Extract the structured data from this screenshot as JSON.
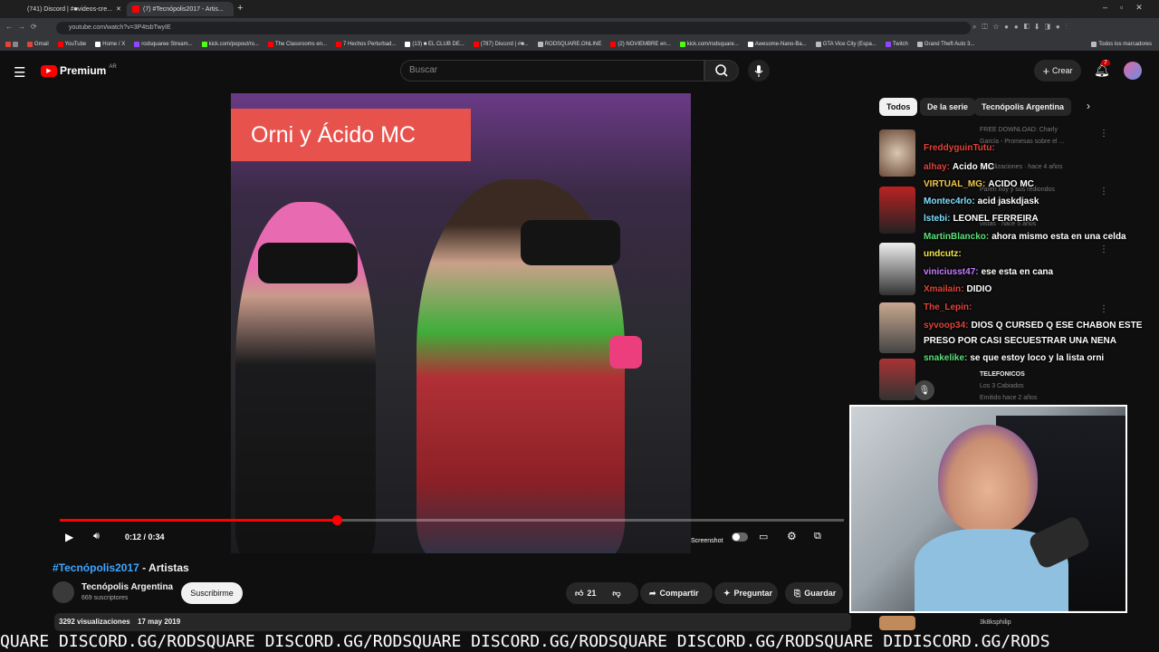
{
  "browser": {
    "tabs": [
      {
        "label": "(741) Discord | #■videos-cre...",
        "active": false
      },
      {
        "label": "(7) #Tecnópolis2017 - Artis...",
        "active": true
      }
    ],
    "url": "youtube.com/watch?v=3P4tsbTwyIE",
    "bookmarks": [
      "Gmail",
      "YouTube",
      "Home / X",
      "rodsquaree Stream...",
      "kick.com/popout/ro...",
      "The Classrooms en...",
      "7 Hechos Perturbad...",
      "(13) ■ EL CLUB DE...",
      "(787) Discord | #■...",
      "RODSQUARE.ONLINE",
      "(2) NOVIEMBRE en...",
      "kick.com/rodsquare...",
      "Awesome-Nano-Ba...",
      "GTA Vice City (Espa...",
      "Twitch",
      "Grand Theft Auto 3..."
    ],
    "all_bookmarks": "Todos los marcadores"
  },
  "youtube": {
    "logo_text": "Premium",
    "logo_region": "AR",
    "search_placeholder": "Buscar",
    "create_label": "Crear",
    "notif_count": "7"
  },
  "video": {
    "caption": "Orni y Ácido MC",
    "time": "0:12 / 0:34",
    "progress": 0.353,
    "screenshot_label": "Screenshot",
    "title_hashtag": "#Tecnópolis2017",
    "title_rest": " - Artistas",
    "channel": "Tecnópolis Argentina",
    "subscribers": "669 suscriptores",
    "subscribe_label": "Suscribirme",
    "likes": "21",
    "share_label": "Compartir",
    "ask_label": "Preguntar",
    "save_label": "Guardar",
    "views": "3292 visualizaciones",
    "date": "17 may 2019"
  },
  "chips": [
    {
      "label": "Todos",
      "selected": true
    },
    {
      "label": "De la serie",
      "selected": false
    },
    {
      "label": "Tecnópolis Argentina",
      "selected": false
    }
  ],
  "sidebar_ghost": [
    "FREE DOWNLOAD: Charly",
    "García - Promesas sobre el ...",
    "visualizaciones · hace 4 años",
    "Paren hoy y sus rediondos",
    "en mi Ciuda...",
    "vistas · hace 5 años",
    "Los 3 Cabiados",
    "Emitido hace 2 años",
    "3k8ksphilip",
    "TELEFONICOS"
  ],
  "chat": [
    {
      "user": "FreddyguinTutu:",
      "msg": "",
      "color": "#e0443a"
    },
    {
      "user": "alhay:",
      "msg": "Acido MC",
      "color": "#e0443a"
    },
    {
      "user": "VIRTUAL_MG:",
      "msg": "ACIDO MC",
      "color": "#f2c94c"
    },
    {
      "user": "Montec4rlo:",
      "msg": "acid jaskdjask",
      "color": "#7fe0ff"
    },
    {
      "user": "lstebi:",
      "msg": "LEONEL FERREIRA",
      "color": "#7fe0ff"
    },
    {
      "user": "MartinBlancko:",
      "msg": "ahora mismo esta en una celda",
      "color": "#5ce07a"
    },
    {
      "user": "undcutz:",
      "msg": "",
      "color": "#f2e54c"
    },
    {
      "user": "viniciusst47:",
      "msg": "ese esta en cana",
      "color": "#c77dff"
    },
    {
      "user": "Xmailain:",
      "msg": "DIDIO",
      "color": "#e0443a"
    },
    {
      "user": "The_Lepin:",
      "msg": "",
      "color": "#e0443a"
    },
    {
      "user": "syvoop34:",
      "msg": "DIOS Q CURSED Q ESE CHABON ESTE",
      "color": "#e0443a"
    },
    {
      "user": "",
      "msg": "PRESO POR CASI SECUESTRAR UNA NENA",
      "color": "#fff"
    },
    {
      "user": "snakelike:",
      "msg": "se que estoy loco y la lista orni",
      "color": "#5ce07a"
    }
  ],
  "ticker": "QUARE DISCORD.GG/RODSQUARE DISCORD.GG/RODSQUARE DISCORD.GG/RODSQUARE DISCORD.GG/RODSQUARE DIDISCORD.GG/RODS",
  "colors": {
    "accent_red": "#ff0000",
    "bg": "#0f0f0f",
    "caption_bg": "#e8524c"
  }
}
